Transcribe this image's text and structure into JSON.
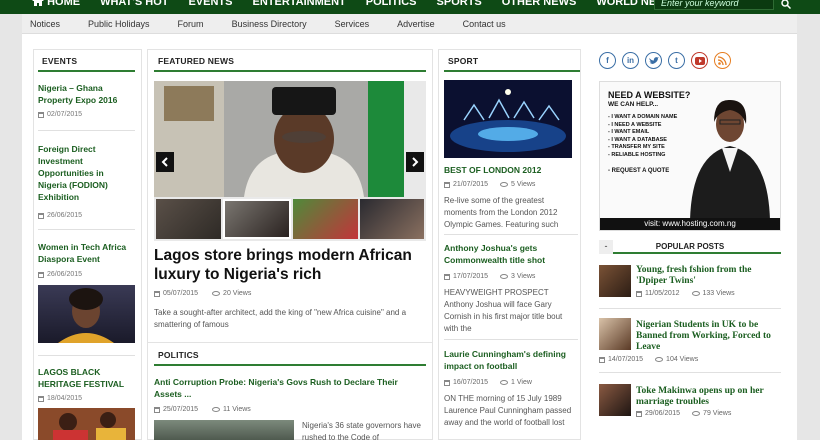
{
  "topnav": {
    "items": [
      "HOME",
      "WHAT'S HOT",
      "EVENTS",
      "ENTERTAINMENT",
      "POLITICS",
      "SPORTS",
      "OTHER NEWS",
      "WORLD NEWS"
    ],
    "search_placeholder": "Enter your keyword"
  },
  "secnav": {
    "items": [
      "Notices",
      "Public Holidays",
      "Forum",
      "Business Directory",
      "Services",
      "Advertise",
      "Contact us"
    ]
  },
  "events": {
    "heading": "EVENTS",
    "items": [
      {
        "title": "Nigeria – Ghana Property Expo 2016",
        "date": "02/07/2015"
      },
      {
        "title": "Foreign Direct Investment Opportunities in Nigeria (FODION) Exhibition",
        "date": "26/06/2015"
      },
      {
        "title": "Women in Tech Africa Diaspora Event",
        "date": "26/06/2015"
      },
      {
        "title": "LAGOS BLACK HERITAGE FESTIVAL",
        "date": "18/04/2015"
      }
    ]
  },
  "featured": {
    "heading": "FEATURED NEWS",
    "title": "Lagos store brings modern African luxury to Nigeria's rich",
    "date": "05/07/2015",
    "views": "20 Views",
    "excerpt": "Take a sought-after architect, add the king of \"new Africa cuisine\" and a smattering of famous"
  },
  "politics": {
    "heading": "POLITICS",
    "title": "Anti Corruption Probe: Nigeria's Govs Rush to Declare Their Assets ...",
    "date": "25/07/2015",
    "views": "11 Views",
    "excerpt": "Nigeria's 36 state governors have rushed to the Code of"
  },
  "sport": {
    "heading": "SPORT",
    "items": [
      {
        "title": "BEST OF LONDON 2012",
        "date": "21/07/2015",
        "views": "5 Views",
        "excerpt": "Re-live some of the greatest moments from the London 2012 Olympic Games. Featuring such"
      },
      {
        "title": "Anthony Joshua's gets Commonwealth title shot",
        "date": "17/07/2015",
        "views": "3 Views",
        "excerpt": "HEAVYWEIGHT PROSPECT Anthony Joshua will face Gary Cornish in his first major title bout with the"
      },
      {
        "title": "Laurie Cunningham's defining impact on football",
        "date": "16/07/2015",
        "views": "1 View",
        "excerpt": "ON THE morning of 15 July 1989 Laurence Paul Cunningham passed away and the world of football lost"
      }
    ]
  },
  "social": {
    "icons": [
      "f",
      "in",
      "t",
      "t",
      "▶",
      "rss"
    ]
  },
  "ad": {
    "heading": "NEED A WEBSITE?",
    "subheading": "WE CAN HELP...",
    "list": [
      "- I WANT A DOMAIN NAME",
      "- I NEED A WEBSITE",
      "- I WANT EMAIL",
      "- I WANT A DATABASE",
      "- TRANSFER MY SITE",
      "- RELIABLE HOSTING"
    ],
    "cta": "- REQUEST A QUOTE",
    "footer": "visit: www.hosting.com.ng"
  },
  "popular": {
    "tab": "-",
    "heading": "POPULAR POSTS",
    "items": [
      {
        "title": "Young, fresh fshion from the 'Dpiper Twins'",
        "date": "11/05/2012",
        "views": "133 Views"
      },
      {
        "title": "Nigerian Students in UK to be Banned from Working, Forced to Leave",
        "date": "14/07/2015",
        "views": "104 Views"
      },
      {
        "title": "Toke Makinwa opens up on her marriage troubles",
        "date": "29/06/2015",
        "views": "79 Views"
      }
    ]
  }
}
